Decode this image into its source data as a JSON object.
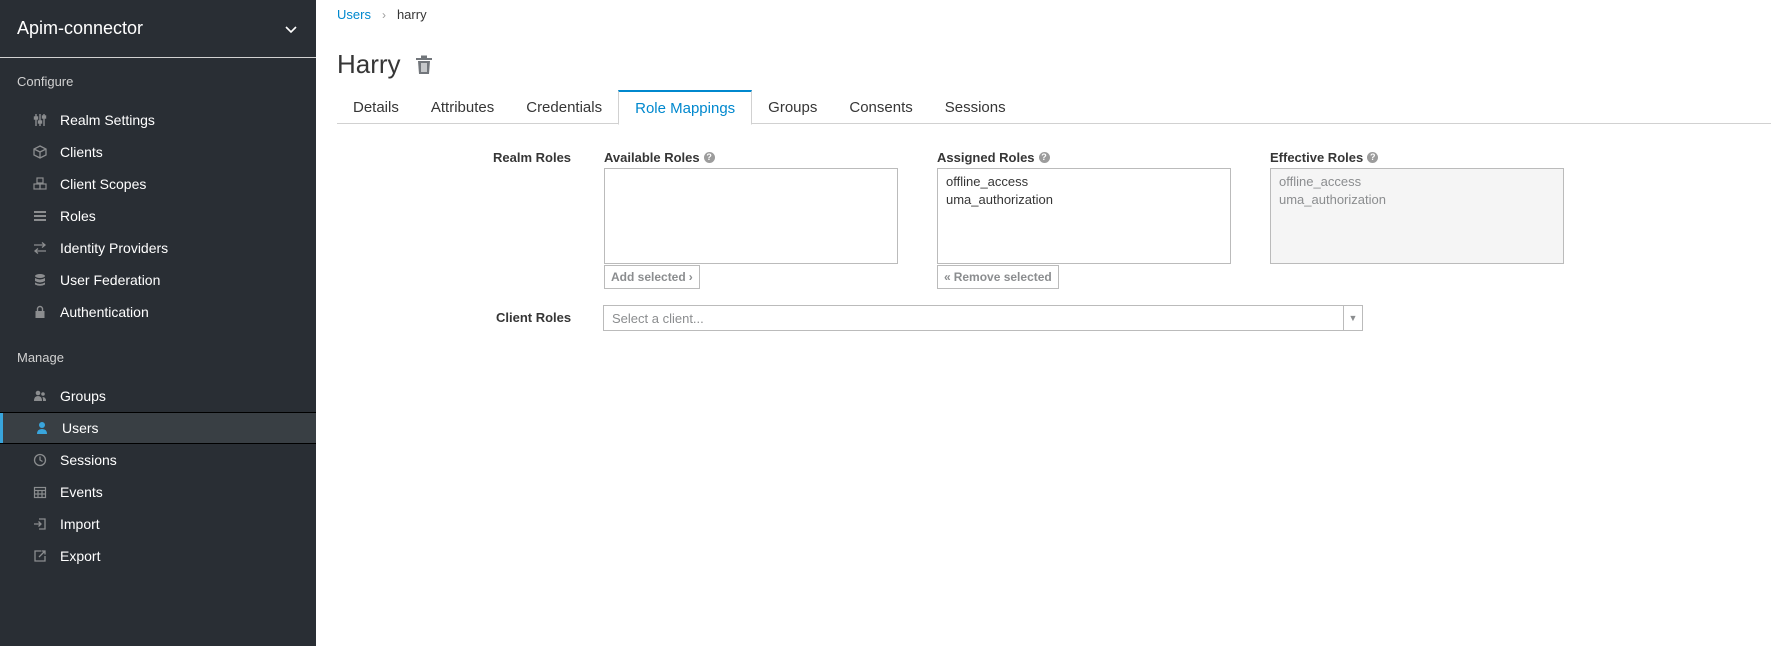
{
  "sidebar": {
    "realm_name": "Apim-connector",
    "configure_title": "Configure",
    "configure_items": [
      {
        "label": "Realm Settings",
        "icon": "sliders-icon"
      },
      {
        "label": "Clients",
        "icon": "cube-icon"
      },
      {
        "label": "Client Scopes",
        "icon": "cubes-icon"
      },
      {
        "label": "Roles",
        "icon": "list-icon"
      },
      {
        "label": "Identity Providers",
        "icon": "exchange-icon"
      },
      {
        "label": "User Federation",
        "icon": "database-icon"
      },
      {
        "label": "Authentication",
        "icon": "lock-icon"
      }
    ],
    "manage_title": "Manage",
    "manage_items": [
      {
        "label": "Groups",
        "icon": "users-icon"
      },
      {
        "label": "Users",
        "icon": "user-icon",
        "active": true
      },
      {
        "label": "Sessions",
        "icon": "clock-icon"
      },
      {
        "label": "Events",
        "icon": "calendar-icon"
      },
      {
        "label": "Import",
        "icon": "import-icon"
      },
      {
        "label": "Export",
        "icon": "export-icon"
      }
    ],
    "active_color": "#39a5dc"
  },
  "breadcrumb": {
    "parent": "Users",
    "current": "harry"
  },
  "page": {
    "title": "Harry"
  },
  "tabs": [
    {
      "label": "Details"
    },
    {
      "label": "Attributes"
    },
    {
      "label": "Credentials"
    },
    {
      "label": "Role Mappings",
      "active": true
    },
    {
      "label": "Groups"
    },
    {
      "label": "Consents"
    },
    {
      "label": "Sessions"
    }
  ],
  "realm_roles": {
    "label": "Realm Roles",
    "available": {
      "label": "Available Roles",
      "items": []
    },
    "assigned": {
      "label": "Assigned Roles",
      "items": [
        "offline_access",
        "uma_authorization"
      ]
    },
    "effective": {
      "label": "Effective Roles",
      "items": [
        "offline_access",
        "uma_authorization"
      ]
    },
    "add_button": "Add selected",
    "remove_button": "Remove selected"
  },
  "client_roles": {
    "label": "Client Roles",
    "select_placeholder": "Select a client..."
  },
  "colors": {
    "link": "#0088ce",
    "sidebar_bg": "#292e34"
  }
}
